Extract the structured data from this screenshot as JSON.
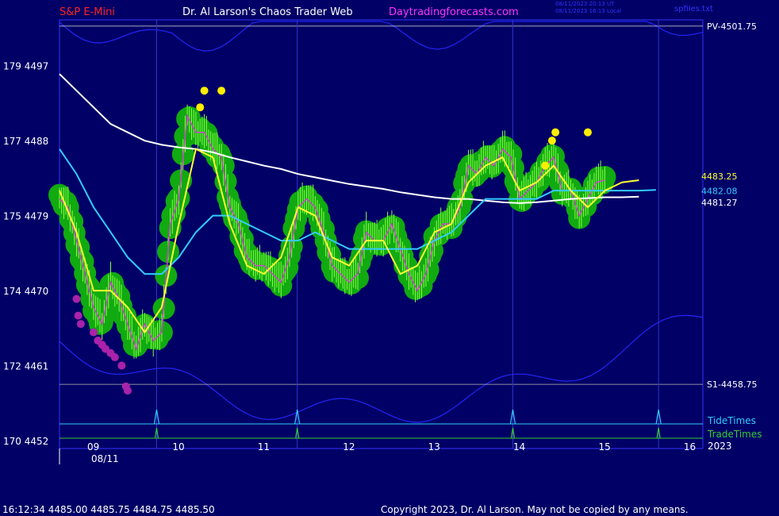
{
  "header": {
    "symbol": "S&P E-Mini",
    "site": "Dr. Al Larson's Chaos Trader Web",
    "url": "Daytradingforecasts.com",
    "timestamp_utc": "08/11/2023 20:13 UT",
    "timestamp_local": "08/11/2023 16:13 Local",
    "file": "spfiles.txt"
  },
  "footer": {
    "quote": "16:12:34  4485.00 4485.75 4484.75 4485.50",
    "copyright": "Copyright 2023, Dr. Al Larson. May not be copied by any means."
  },
  "colors": {
    "background": "#000066",
    "frame": "#3333ff",
    "price": "#88ff44",
    "bubble": "#11aa11",
    "fast_avg": "#ffff33",
    "medium_avg": "#33ccff",
    "slow_avg": "#ffffff",
    "envelope": "#2222ee",
    "tide": "#33ccff",
    "trade": "#33cc33",
    "magenta_dots": "#aa22aa",
    "yellow_dots": "#ffee00"
  },
  "chart_data": {
    "type": "line",
    "title": "S&P E-Mini",
    "date_label": "08/11",
    "year_label": "2023",
    "x_ticks": [
      "09",
      "10",
      "11",
      "12",
      "13",
      "14",
      "15",
      "16"
    ],
    "y_ticks": [
      {
        "label": "179  4497",
        "value": 4497
      },
      {
        "label": "177  4488",
        "value": 4488
      },
      {
        "label": "175  4479",
        "value": 4479
      },
      {
        "label": "174  4470",
        "value": 4470
      },
      {
        "label": "172  4461",
        "value": 4461
      },
      {
        "label": "170  4452",
        "value": 4452
      }
    ],
    "ylim": [
      4452,
      4502.5
    ],
    "xlim": [
      8.6,
      16.15
    ],
    "levels": [
      {
        "name": "PV",
        "label": "PV-4501.75",
        "value": 4501.75
      },
      {
        "name": "S1",
        "label": "S1-4458.75",
        "value": 4458.75
      }
    ],
    "last_values": [
      {
        "label": "4483.25",
        "color": "#ffff33"
      },
      {
        "label": "4482.08",
        "color": "#33ccff"
      },
      {
        "label": "4481.27",
        "color": "#ffffff"
      }
    ],
    "price_series": {
      "x": [
        8.6,
        8.7,
        8.8,
        8.9,
        9.0,
        9.1,
        9.2,
        9.3,
        9.4,
        9.5,
        9.6,
        9.7,
        9.8,
        9.9,
        10.0,
        10.1,
        10.2,
        10.3,
        10.4,
        10.5,
        10.6,
        10.7,
        10.8,
        10.9,
        11.0,
        11.1,
        11.2,
        11.3,
        11.4,
        11.5,
        11.6,
        11.7,
        11.8,
        11.9,
        12.0,
        12.1,
        12.2,
        12.3,
        12.4,
        12.5,
        12.6,
        12.7,
        12.8,
        12.9,
        13.0,
        13.1,
        13.2,
        13.3,
        13.4,
        13.5,
        13.6,
        13.7,
        13.8,
        13.9,
        14.0,
        14.1,
        14.2,
        14.3,
        14.4,
        14.5,
        14.6,
        14.7,
        14.8,
        14.9,
        15.0,
        15.1,
        15.2,
        15.3,
        15.4,
        15.5,
        15.6,
        15.7,
        15.8,
        15.9,
        16.0,
        16.1
      ],
      "y": [
        4481,
        4480,
        4476,
        4472,
        4468,
        4466,
        4471,
        4469,
        4466,
        4463,
        4466,
        4464,
        4465,
        4478,
        4481,
        4491,
        4489,
        4489,
        4487,
        4486,
        4480,
        4478,
        4474,
        4473,
        4473,
        4472,
        4471,
        4474,
        4480,
        4481,
        4480,
        4477,
        4473,
        4472,
        4471,
        4472,
        4477,
        4476,
        4476,
        4478,
        4475,
        4472,
        4470,
        4472,
        4476,
        4478,
        4478,
        4480,
        4485,
        4484,
        4486,
        4485,
        4487,
        4486,
        4481,
        4482,
        4483,
        4485,
        4486,
        4482,
        4482,
        4479,
        4481,
        4483,
        4483.25
      ]
    },
    "fast_avg": {
      "x": [
        8.6,
        8.8,
        9.0,
        9.2,
        9.4,
        9.6,
        9.8,
        10.0,
        10.2,
        10.4,
        10.6,
        10.8,
        11.0,
        11.2,
        11.4,
        11.6,
        11.8,
        12.0,
        12.2,
        12.4,
        12.6,
        12.8,
        13.0,
        13.2,
        13.4,
        13.6,
        13.8,
        14.0,
        14.2,
        14.4,
        14.6,
        14.8,
        15.0,
        15.2,
        15.4,
        15.6,
        15.8,
        16.0,
        16.1
      ],
      "y": [
        4482,
        4477,
        4470,
        4470,
        4468,
        4465,
        4468,
        4478,
        4487,
        4486,
        4478,
        4473,
        4472,
        4474,
        4480,
        4479,
        4474,
        4473,
        4476,
        4476,
        4472,
        4473,
        4477,
        4478,
        4483,
        4485,
        4486,
        4482,
        4483,
        4485,
        4482,
        4480,
        4482,
        4483,
        4483.25
      ]
    },
    "medium_avg": {
      "x": [
        8.6,
        8.8,
        9.0,
        9.2,
        9.4,
        9.6,
        9.8,
        10.0,
        10.2,
        10.4,
        10.6,
        10.8,
        11.0,
        11.2,
        11.4,
        11.6,
        11.8,
        12.0,
        12.2,
        12.4,
        12.6,
        12.8,
        13.0,
        13.2,
        13.4,
        13.6,
        13.8,
        14.0,
        14.2,
        14.4,
        14.6,
        14.8,
        15.0,
        15.2,
        15.4,
        15.6,
        15.8,
        16.0,
        16.1
      ],
      "y": [
        4487,
        4484,
        4480,
        4477,
        4474,
        4472,
        4472,
        4474,
        4477,
        4479,
        4479,
        4478,
        4477,
        4476,
        4476,
        4477,
        4476,
        4475,
        4475,
        4475,
        4475,
        4475,
        4476,
        4477,
        4479,
        4481,
        4481,
        4481,
        4481,
        4482,
        4482,
        4482,
        4482,
        4482,
        4482,
        4482.08
      ]
    },
    "slow_avg": {
      "x": [
        8.6,
        8.8,
        9.0,
        9.2,
        9.4,
        9.6,
        9.8,
        10.0,
        10.2,
        10.4,
        10.6,
        10.8,
        11.0,
        11.2,
        11.4,
        11.6,
        11.8,
        12.0,
        12.2,
        12.4,
        12.6,
        12.8,
        13.0,
        13.2,
        13.4,
        13.6,
        13.8,
        14.0,
        14.2,
        14.4,
        14.6,
        14.8,
        15.0,
        15.2,
        15.4,
        15.6,
        15.8,
        16.0,
        16.1
      ],
      "y": [
        4496,
        4494,
        4492,
        4490,
        4489,
        4488,
        4487.5,
        4487.2,
        4487,
        4486.6,
        4486,
        4485.5,
        4485,
        4484.6,
        4484,
        4483.6,
        4483.2,
        4482.8,
        4482.5,
        4482.2,
        4481.8,
        4481.5,
        4481.2,
        4481,
        4481,
        4480.8,
        4480.6,
        4480.5,
        4480.6,
        4480.8,
        4481,
        4481.1,
        4481.2,
        4481.2,
        4481.27
      ]
    },
    "tide_times": [
      9.74,
      11.39,
      13.92,
      15.63
    ],
    "trade_times": [
      9.74,
      11.39,
      13.92,
      15.63
    ],
    "legend": [
      {
        "label": "TideTimes",
        "color": "#33ccff"
      },
      {
        "label": "TradeTimes",
        "color": "#33cc33"
      }
    ],
    "magenta_dots": {
      "x": [
        8.8,
        8.82,
        8.85,
        9.0,
        9.05,
        9.1,
        9.14,
        9.2,
        9.25,
        9.33,
        9.38,
        9.4
      ],
      "y": [
        4469,
        4467,
        4466,
        4465,
        4464,
        4463.5,
        4463,
        4462.5,
        4462,
        4461,
        4458.5,
        4458
      ]
    },
    "yellow_dots": {
      "x": [
        10.25,
        10.3,
        10.5,
        14.3,
        14.38,
        14.42,
        14.8
      ],
      "y": [
        4492,
        4494,
        4494,
        4485,
        4488,
        4489,
        4489
      ]
    }
  }
}
